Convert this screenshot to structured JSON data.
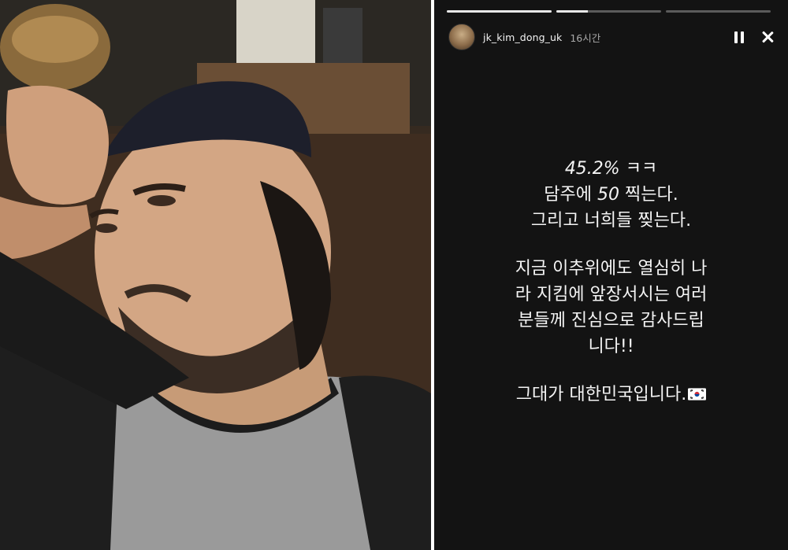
{
  "story": {
    "username": "jk_kim_dong_uk",
    "time_ago": "16시간",
    "progress": [
      1.0,
      0.3,
      0.0
    ],
    "message": {
      "line1_number": "45.2%",
      "line1_suffix": "ㅋㅋ",
      "line2_prefix": "담주에",
      "line2_number": "50",
      "line2_suffix": "찍는다.",
      "line3": "그리고 너희들 찢는다.",
      "line4": "지금 이추위에도 열심히 나",
      "line5": "라 지킴에 앞장서시는 여러",
      "line6": "분들께 진심으로 감사드립",
      "line7": "니다!!",
      "line8": "그대가 대한민국입니다."
    },
    "flag_emoji": "south-korea-flag",
    "colors": {
      "background": "#131313",
      "text": "#f4f4f4",
      "time": "#a8a8a8"
    }
  }
}
